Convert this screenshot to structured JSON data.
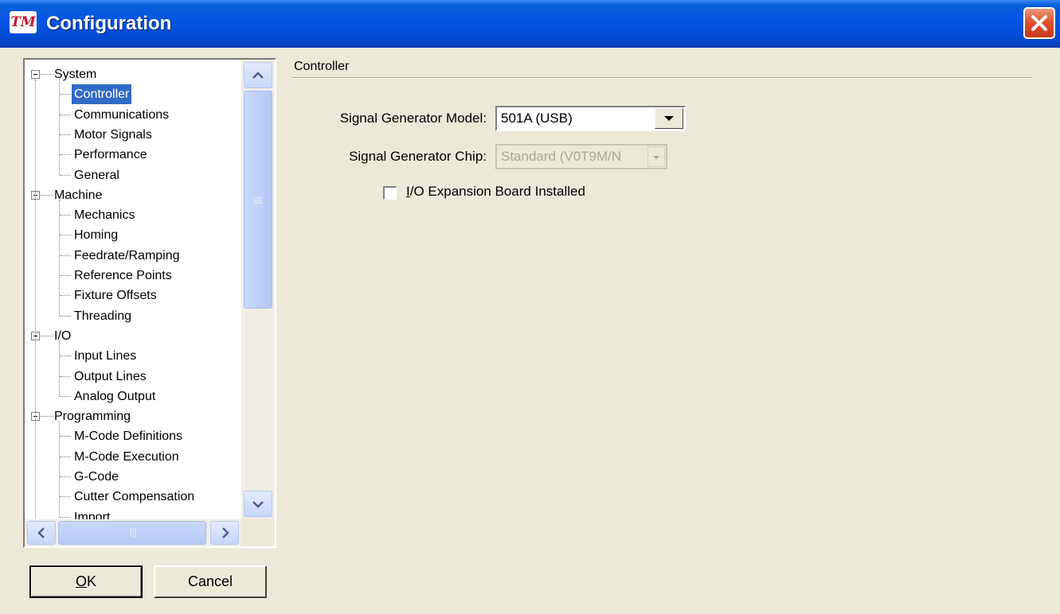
{
  "window": {
    "title": "Configuration",
    "logo_text": "TM",
    "close_icon": "close-icon"
  },
  "tree": {
    "groups": [
      {
        "label": "System",
        "items": [
          "Controller",
          "Communications",
          "Motor Signals",
          "Performance",
          "General"
        ]
      },
      {
        "label": "Machine",
        "items": [
          "Mechanics",
          "Homing",
          "Feedrate/Ramping",
          "Reference Points",
          "Fixture Offsets",
          "Threading"
        ]
      },
      {
        "label": "I/O",
        "items": [
          "Input Lines",
          "Output Lines",
          "Analog Output"
        ]
      },
      {
        "label": "Programming",
        "items": [
          "M-Code Definitions",
          "M-Code Execution",
          "G-Code",
          "Cutter Compensation",
          "Import"
        ]
      }
    ],
    "selected": "Controller"
  },
  "buttons": {
    "ok": {
      "pre": "",
      "mnemonic": "O",
      "post": "K"
    },
    "cancel": "Cancel"
  },
  "panel": {
    "section_title": "Controller",
    "signal_generator_model": {
      "label": "Signal Generator Model:",
      "value": "501A (USB)"
    },
    "signal_generator_chip": {
      "label": "Signal Generator Chip:",
      "value": "Standard (V0T9M/N"
    },
    "io_expansion": {
      "pre": "",
      "mnemonic": "I",
      "post": "/O Expansion Board Installed",
      "checked": false
    }
  }
}
